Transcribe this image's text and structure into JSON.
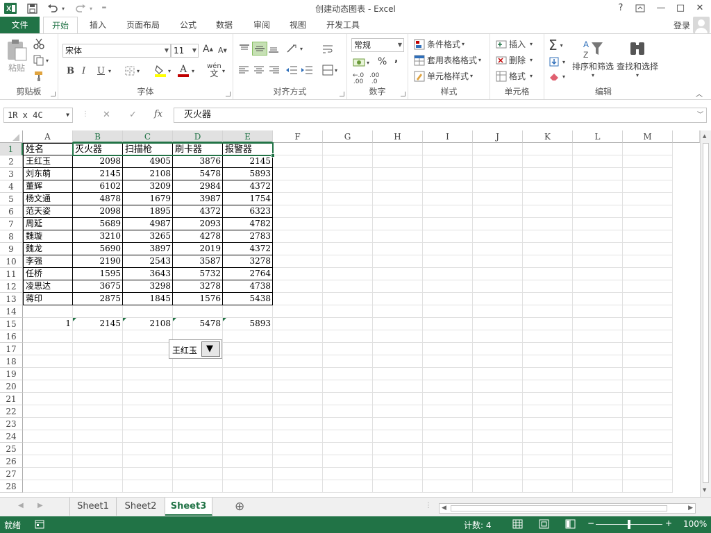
{
  "title_bar": {
    "title": "创建动态图表 - Excel",
    "help": "?",
    "window_buttons": [
      "—",
      "□",
      "✕"
    ]
  },
  "ribbon_tabs": [
    "文件",
    "开始",
    "插入",
    "页面布局",
    "公式",
    "数据",
    "审阅",
    "视图",
    "开发工具"
  ],
  "active_tab": "开始",
  "account": {
    "login": "登录"
  },
  "ribbon": {
    "clipboard": {
      "label": "剪贴板",
      "paste": "粘贴"
    },
    "font": {
      "label": "字体",
      "name": "宋体",
      "size": "11",
      "bold": "B",
      "italic": "I",
      "underline": "U",
      "wen": "wén",
      "font_color": "A"
    },
    "alignment": {
      "label": "对齐方式"
    },
    "number": {
      "label": "数字",
      "format": "常规",
      "percent": "%",
      "comma": ",",
      "inc_decimal": ".00",
      "dec_decimal": ".0"
    },
    "styles": {
      "label": "样式",
      "conditional": "条件格式",
      "table_format": "套用表格格式",
      "cell_styles": "单元格样式"
    },
    "cells": {
      "label": "单元格",
      "insert": "插入",
      "delete": "删除",
      "format": "格式"
    },
    "editing": {
      "label": "编辑",
      "sum_icon": "Σ",
      "sort_filter": "排序和筛选",
      "find_select": "查找和选择"
    }
  },
  "formula_bar": {
    "name_box": "1R x 4C",
    "cancel": "✕",
    "enter": "✓",
    "fx": "fx",
    "content": "灭火器"
  },
  "sheet": {
    "columns": [
      "A",
      "B",
      "C",
      "D",
      "E",
      "F",
      "G",
      "H",
      "I",
      "J",
      "K",
      "L",
      "M"
    ],
    "rows": [
      "1",
      "2",
      "3",
      "4",
      "5",
      "6",
      "7",
      "8",
      "9",
      "10",
      "11",
      "12",
      "13",
      "14",
      "15",
      "16",
      "17",
      "18",
      "19",
      "20",
      "21",
      "22",
      "23",
      "24",
      "25",
      "26",
      "27",
      "28"
    ],
    "header_row": [
      "姓名",
      "灭火器",
      "扫描枪",
      "刷卡器",
      "报警器"
    ],
    "data": [
      [
        "王红玉",
        "2098",
        "4905",
        "3876",
        "2145"
      ],
      [
        "刘东萌",
        "2145",
        "2108",
        "5478",
        "5893"
      ],
      [
        "董辉",
        "6102",
        "3209",
        "2984",
        "4372"
      ],
      [
        "杨文通",
        "4878",
        "1679",
        "3987",
        "1754"
      ],
      [
        "范天姿",
        "2098",
        "1895",
        "4372",
        "6323"
      ],
      [
        "周延",
        "5689",
        "4987",
        "2093",
        "4782"
      ],
      [
        "魏璇",
        "3210",
        "3265",
        "4278",
        "2783"
      ],
      [
        "魏龙",
        "5690",
        "3897",
        "2019",
        "4372"
      ],
      [
        "李强",
        "2190",
        "2543",
        "3587",
        "3278"
      ],
      [
        "任桥",
        "1595",
        "3643",
        "5732",
        "2764"
      ],
      [
        "凌思达",
        "3675",
        "3298",
        "3278",
        "4738"
      ],
      [
        "蒋印",
        "2875",
        "1845",
        "1576",
        "5438"
      ]
    ],
    "row15": [
      "1",
      "2145",
      "2108",
      "5478",
      "5893"
    ],
    "combo_value": "王红玉",
    "combo_arrow": "▼"
  },
  "sheet_tabs": [
    "Sheet1",
    "Sheet2",
    "Sheet3"
  ],
  "active_sheet": "Sheet3",
  "add_sheet": "⊕",
  "status": {
    "ready": "就绪",
    "count": "计数: 4",
    "zoom": "100%",
    "zoom_minus": "−",
    "zoom_plus": "+"
  },
  "colors": {
    "accent": "#217346"
  }
}
